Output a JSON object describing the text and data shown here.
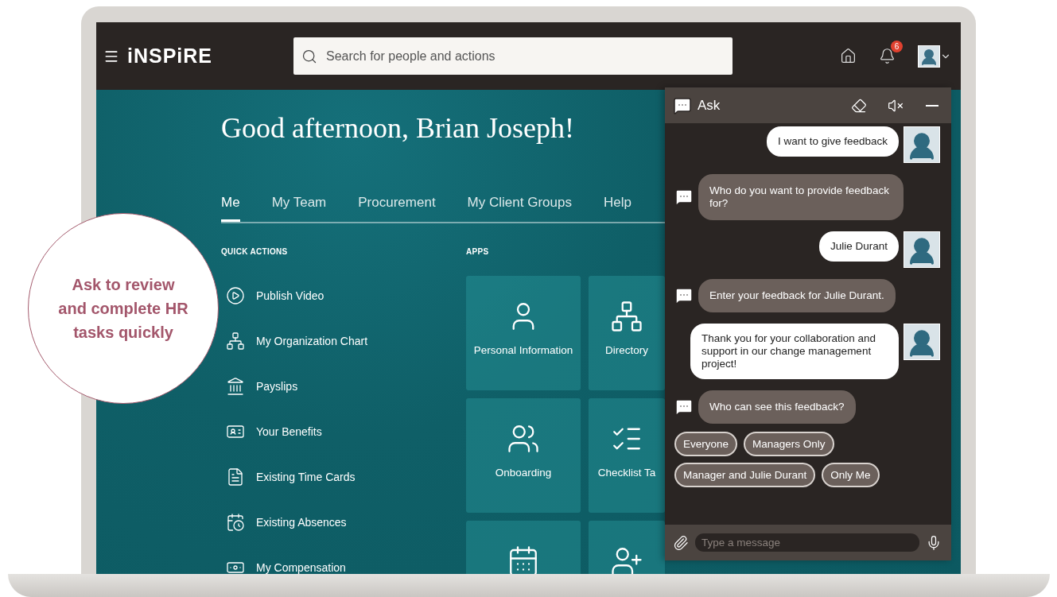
{
  "header": {
    "logo": "iNSPiRE",
    "search": {
      "placeholder": "Search for people and actions"
    },
    "notifications": {
      "badge": "6"
    }
  },
  "greeting": "Good afternoon, Brian Joseph!",
  "tabs": [
    {
      "label": "Me",
      "selected": true
    },
    {
      "label": "My Team",
      "selected": false
    },
    {
      "label": "Procurement",
      "selected": false
    },
    {
      "label": "My Client Groups",
      "selected": false
    },
    {
      "label": "Help",
      "selected": false
    }
  ],
  "quick_actions": {
    "title": "QUICK ACTIONS",
    "items": [
      {
        "label": "Publish Video",
        "kind": "video"
      },
      {
        "label": "My Organization Chart",
        "kind": "org"
      },
      {
        "label": "Payslips",
        "kind": "bank"
      },
      {
        "label": "Your Benefits",
        "kind": "badge"
      },
      {
        "label": "Existing Time Cards",
        "kind": "document"
      },
      {
        "label": "Existing Absences",
        "kind": "calendar-clock"
      },
      {
        "label": "My Compensation",
        "kind": "money"
      }
    ]
  },
  "apps": {
    "title": "APPS",
    "tiles": [
      {
        "label": "Personal Information",
        "kind": "person"
      },
      {
        "label": "Directory",
        "kind": "org"
      },
      {
        "label": "Onboarding",
        "kind": "people"
      },
      {
        "label": "Checklist Ta",
        "kind": "checklist"
      },
      {
        "kind": "calendar"
      },
      {
        "kind": "person-plus"
      }
    ]
  },
  "chat": {
    "title": "Ask",
    "messages": [
      {
        "kind": "user",
        "text": "I want to give feedback"
      },
      {
        "kind": "bot",
        "text": "Who do you want to provide feedback for?"
      },
      {
        "kind": "user",
        "text": "Julie Durant"
      },
      {
        "kind": "bot",
        "text": "Enter your feedback for Julie Durant."
      },
      {
        "kind": "user",
        "text": "Thank you for your collaboration and support in our change management project!"
      },
      {
        "kind": "bot",
        "text": "Who can see this feedback?"
      }
    ],
    "options": [
      "Everyone",
      "Managers Only",
      "Manager and Julie Durant",
      "Only Me"
    ],
    "input": {
      "placeholder": "Type a message"
    }
  },
  "callout": "Ask to review and complete HR tasks quickly"
}
